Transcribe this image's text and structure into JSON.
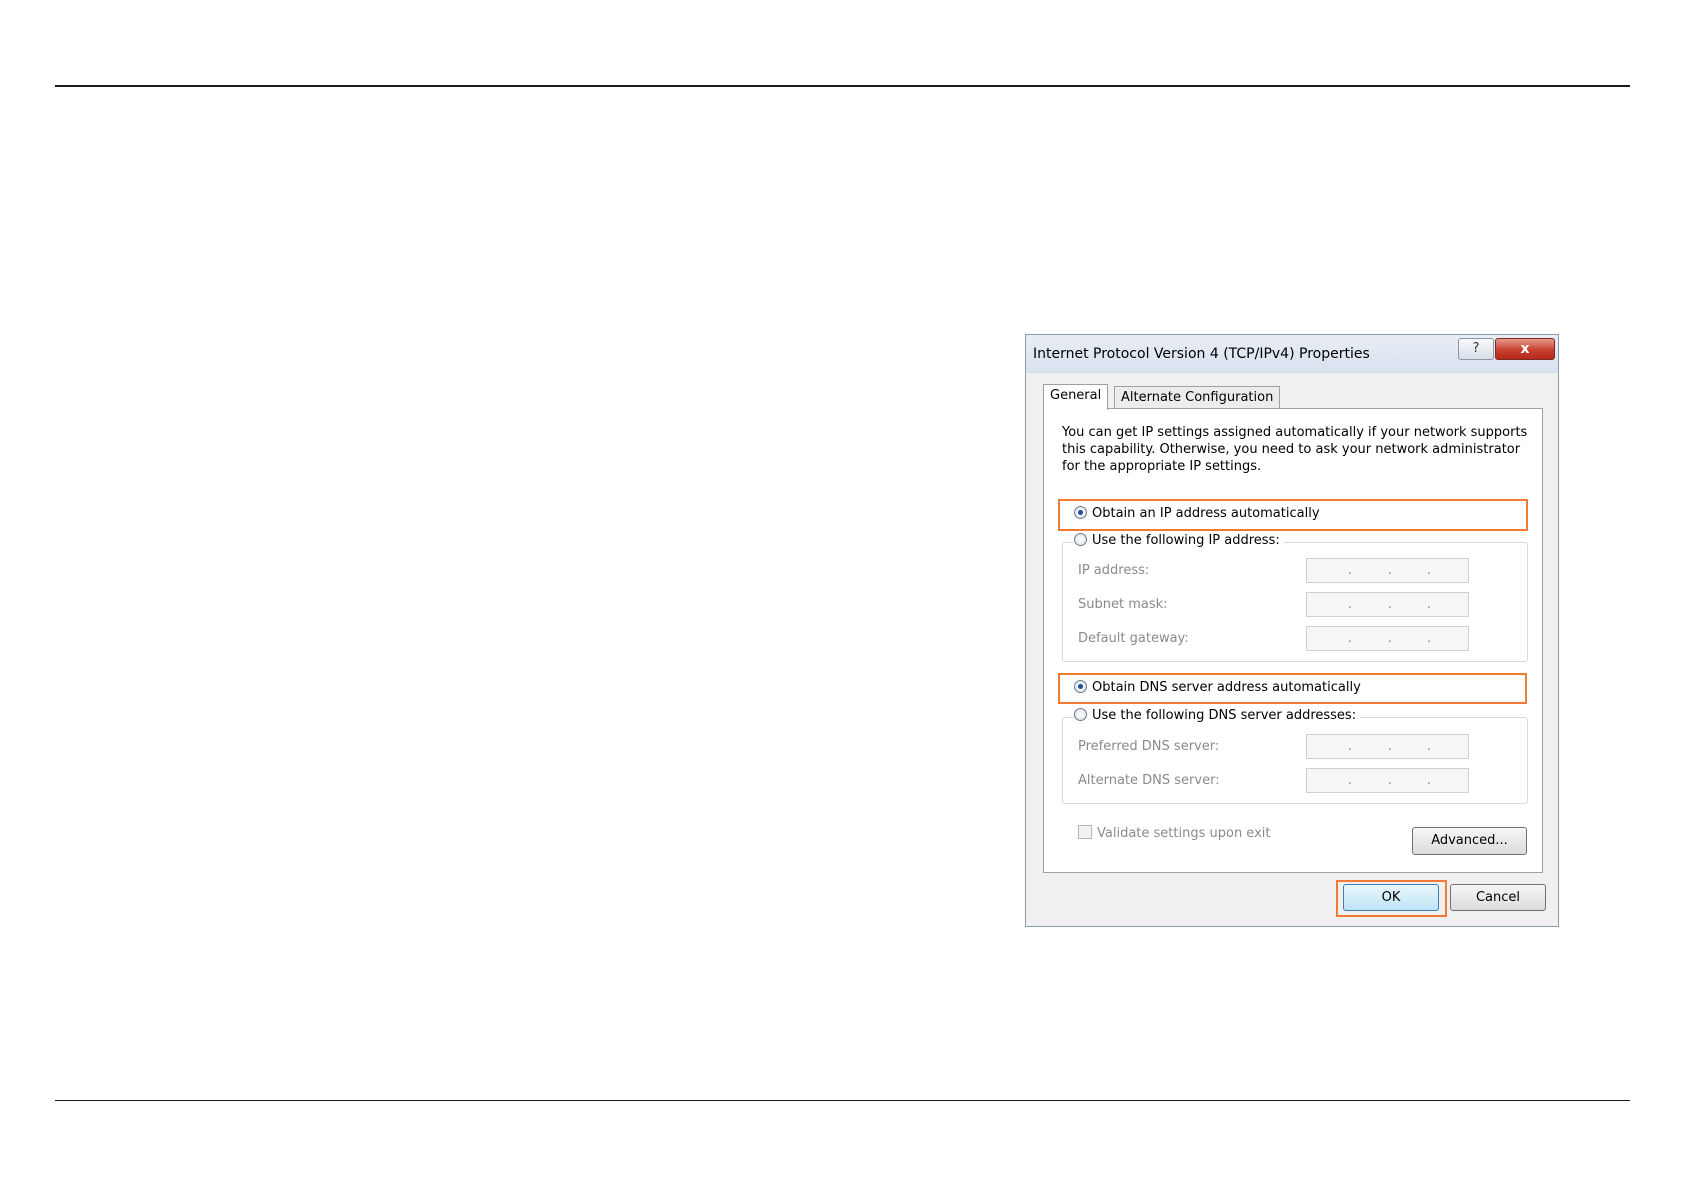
{
  "dialog": {
    "title": "Internet Protocol Version 4 (TCP/IPv4) Properties",
    "help_glyph": "?",
    "close_glyph": "x"
  },
  "tabs": [
    {
      "label": "General",
      "active": true
    },
    {
      "label": "Alternate Configuration",
      "active": false
    }
  ],
  "intro": "You can get IP settings assigned automatically if your network supports this capability. Otherwise, you need to ask your network administrator for the appropriate IP settings.",
  "ip": {
    "auto_label": "Obtain an IP address automatically",
    "auto_selected": true,
    "manual_label": "Use the following IP address:",
    "fields": [
      {
        "label": "IP address:"
      },
      {
        "label": "Subnet mask:"
      },
      {
        "label": "Default gateway:"
      }
    ]
  },
  "dns": {
    "auto_label": "Obtain DNS server address automatically",
    "auto_selected": true,
    "manual_label": "Use the following DNS server addresses:",
    "fields": [
      {
        "label": "Preferred DNS server:"
      },
      {
        "label": "Alternate DNS server:"
      }
    ]
  },
  "validate_label": "Validate settings upon exit",
  "buttons": {
    "advanced": "Advanced...",
    "ok": "OK",
    "cancel": "Cancel"
  },
  "colors": {
    "highlight": "#ef7b35",
    "close": "#c7402f"
  }
}
